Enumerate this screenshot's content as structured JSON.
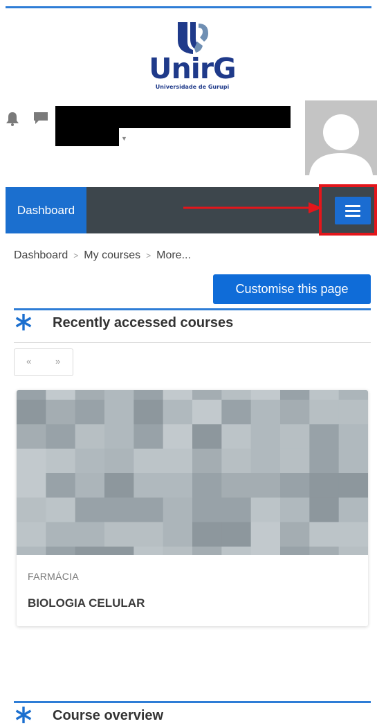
{
  "logo": {
    "wordmark": "UnirG",
    "subtitle": "Universidade de Gurupi",
    "colors": {
      "primary": "#1f3a8a",
      "secondary": "#6f8fb3"
    }
  },
  "header": {
    "icons": [
      "bell-icon",
      "chat-icon",
      "caret-down-icon",
      "user-avatar-icon"
    ]
  },
  "navbar": {
    "dashboard_label": "Dashboard",
    "menu_icon": "hamburger-icon",
    "highlight_color": "#e4161b"
  },
  "breadcrumb": {
    "items": [
      "Dashboard",
      "My courses",
      "More..."
    ]
  },
  "customise_button": {
    "label": "Customise this page"
  },
  "recent_block": {
    "title": "Recently accessed courses",
    "pager": {
      "prev": "«",
      "next": "»"
    },
    "courses": [
      {
        "category": "FARMÁCIA",
        "name": "BIOLOGIA CELULAR"
      }
    ]
  },
  "overview_block": {
    "title": "Course overview"
  },
  "colors": {
    "accent": "#0f6cd8",
    "navbar": "#3d464c",
    "block_rule": "#2e7dd6"
  }
}
